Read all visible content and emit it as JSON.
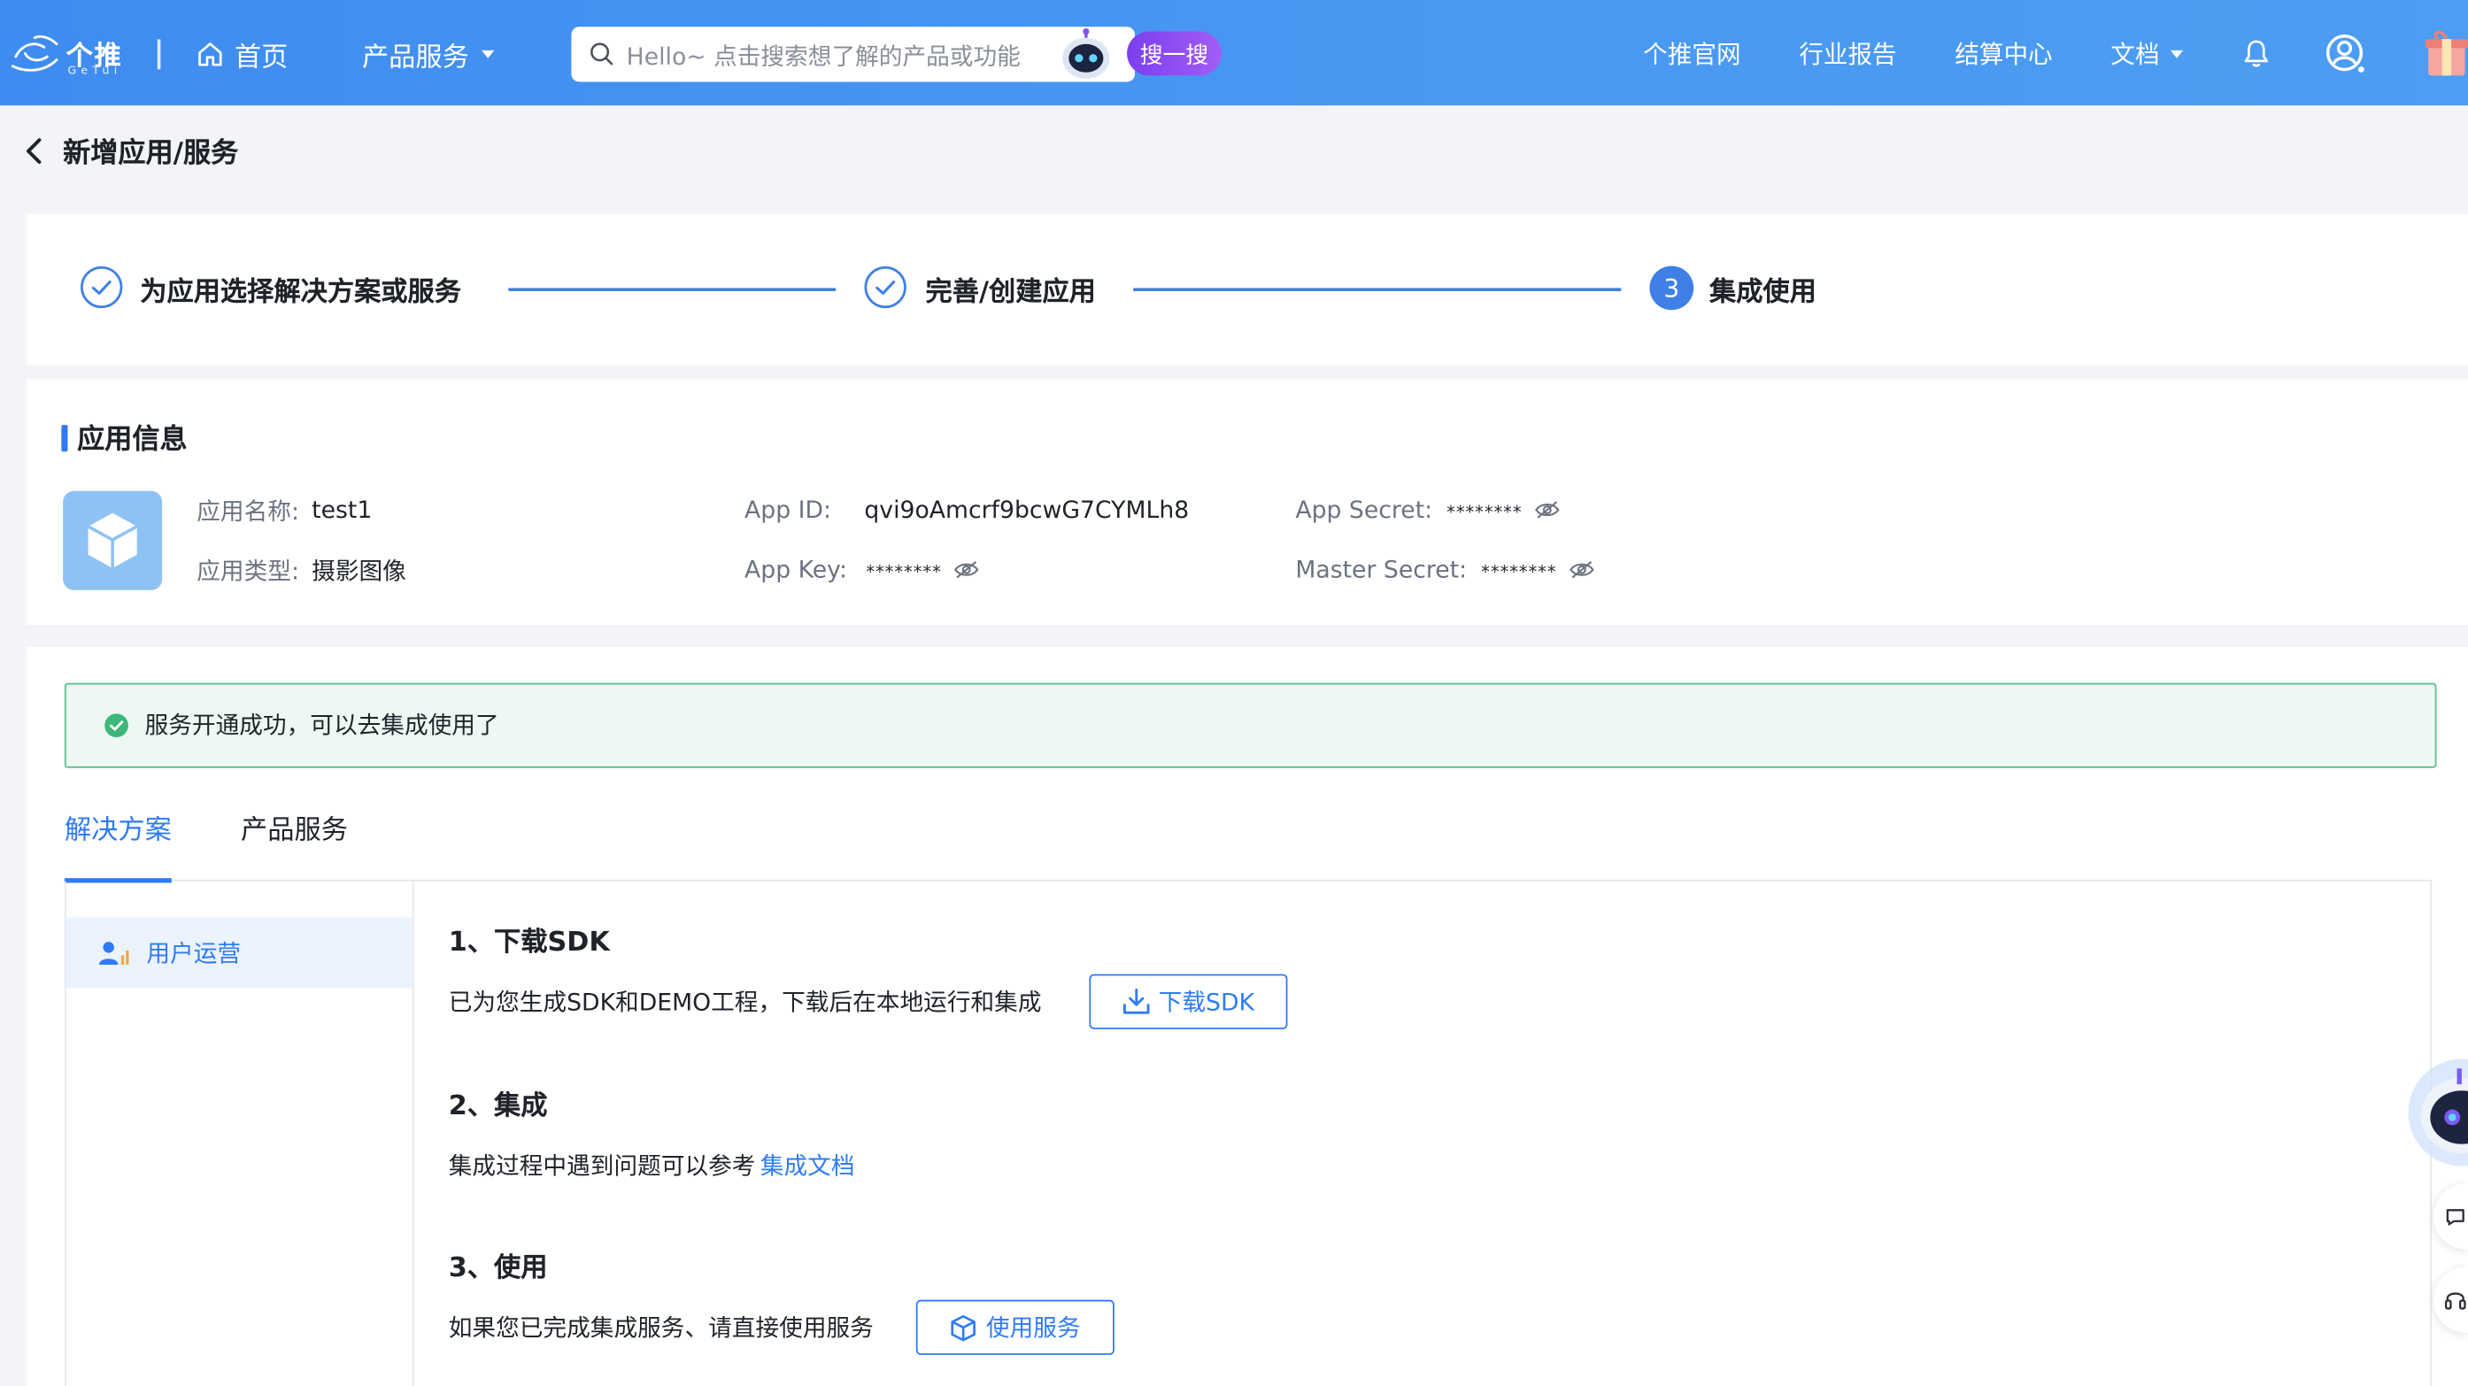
{
  "header": {
    "logo_text": "个推",
    "logo_sub": "GeTui",
    "nav": [
      {
        "label": "首页",
        "icon": "home-icon"
      },
      {
        "label": "产品服务",
        "icon": "caret-down-icon"
      }
    ],
    "search": {
      "placeholder": "Hello~ 点击搜索想了解的产品或功能",
      "button": "搜一搜"
    },
    "right_nav": [
      {
        "label": "个推官网"
      },
      {
        "label": "行业报告"
      },
      {
        "label": "结算中心"
      },
      {
        "label": "文档"
      }
    ]
  },
  "page": {
    "title": "新增应用/服务"
  },
  "steps": [
    {
      "label": "为应用选择解决方案或服务",
      "status": "done"
    },
    {
      "label": "完善/创建应用",
      "status": "done"
    },
    {
      "label": "集成使用",
      "status": "current",
      "number": "3"
    }
  ],
  "app_info": {
    "section_title": "应用信息",
    "name_label": "应用名称:",
    "name_value": "test1",
    "type_label": "应用类型:",
    "type_value": "摄影图像",
    "app_id_label": "App ID:",
    "app_id_value": "qvi9oAmcrf9bcwG7CYMLh8",
    "app_key_label": "App Key:",
    "app_key_value": "********",
    "app_secret_label": "App Secret:",
    "app_secret_value": "********",
    "master_secret_label": "Master Secret:",
    "master_secret_value": "********"
  },
  "alert": {
    "text": "服务开通成功，可以去集成使用了"
  },
  "tabs": [
    {
      "label": "解决方案",
      "active": true
    },
    {
      "label": "产品服务",
      "active": false
    }
  ],
  "sidebar": {
    "items": [
      {
        "label": "用户运营",
        "active": true
      }
    ]
  },
  "guide": {
    "step1_title": "1、下载SDK",
    "step1_desc": "已为您生成SDK和DEMO工程，下载后在本地运行和集成",
    "step1_button": "下载SDK",
    "step2_title": "2、集成",
    "step2_desc": "集成过程中遇到问题可以参考",
    "step2_link": "集成文档",
    "step3_title": "3、使用",
    "step3_desc": "如果您已完成集成服务、请直接使用服务",
    "step3_button": "使用服务"
  },
  "colors": {
    "primary": "#2f7bf6",
    "nav_bg": "#4a98f1",
    "success": "#3cb878",
    "search_button": "#8a4cf2"
  }
}
